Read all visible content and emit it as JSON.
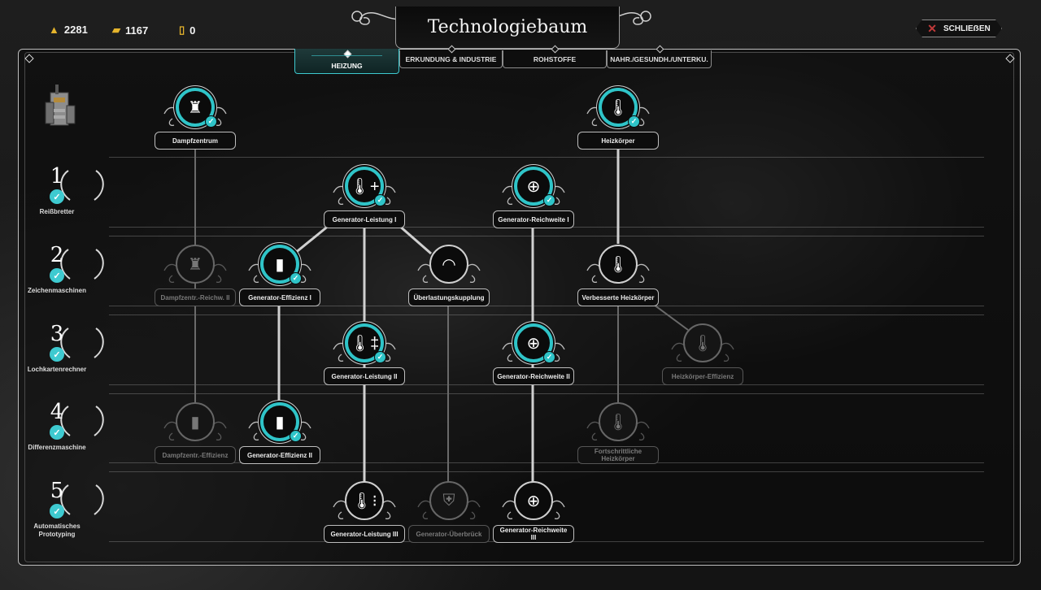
{
  "resources": [
    {
      "icon": "gold-resource-icon",
      "value": "2281"
    },
    {
      "icon": "bar-resource-icon",
      "value": "1167"
    },
    {
      "icon": "core-resource-icon",
      "value": "0"
    }
  ],
  "title": "Technologiebaum",
  "close_label": "SCHLIEẞEN",
  "tabs": [
    {
      "label": "HEIZUNG",
      "active": true
    },
    {
      "label": "ERKUNDUNG & INDUSTRIE",
      "active": false
    },
    {
      "label": "ROHSTOFFE",
      "active": false
    },
    {
      "label": "NAHR./GESUNDH./UNTERKU.",
      "active": false
    }
  ],
  "tiers": [
    {
      "num": "1",
      "label": "Reißbretter"
    },
    {
      "num": "2",
      "label": "Zeichenmaschinen"
    },
    {
      "num": "3",
      "label": "Lochkartenrechner"
    },
    {
      "num": "4",
      "label": "Differenzmaschine"
    },
    {
      "num": "5",
      "label": "Automatisches Prototyping"
    }
  ],
  "accent_color": "#2fc4c8",
  "nodes": {
    "dampfzentrum": {
      "label": "Dampfzentrum",
      "icon": "steam-hub-icon",
      "state": "done"
    },
    "heizkoerper": {
      "label": "Heizkörper",
      "icon": "heater-icon",
      "state": "done"
    },
    "gen_leistung_1": {
      "label": "Generator-Leistung I",
      "icon": "thermometer-plus-icon",
      "state": "done"
    },
    "gen_reichweite_1": {
      "label": "Generator-Reichweite I",
      "icon": "range-icon",
      "state": "done"
    },
    "dampfz_reichw_2": {
      "label": "Dampfzentr.-Reichw. II",
      "icon": "steam-hub-range-icon",
      "state": "locked"
    },
    "gen_effizienz_1": {
      "label": "Generator-Effizienz I",
      "icon": "coal-efficiency-icon",
      "state": "done"
    },
    "ueberlastung": {
      "label": "Überlastungskupplung",
      "icon": "gauge-icon",
      "state": "available"
    },
    "verb_heizkoerper": {
      "label": "Verbesserte Heizkörper",
      "icon": "heater-plus-icon",
      "state": "available"
    },
    "gen_leistung_2": {
      "label": "Generator-Leistung II",
      "icon": "thermometer-double-plus-icon",
      "state": "done"
    },
    "gen_reichweite_2": {
      "label": "Generator-Reichweite II",
      "icon": "range-icon",
      "state": "done"
    },
    "heizk_effizienz": {
      "label": "Heizkörper-Effizienz",
      "icon": "heater-efficiency-icon",
      "state": "locked"
    },
    "dampfz_effizienz": {
      "label": "Dampfzentr.-Effizienz",
      "icon": "steam-hub-efficiency-icon",
      "state": "locked"
    },
    "gen_effizienz_2": {
      "label": "Generator-Effizienz II",
      "icon": "coal-efficiency-icon",
      "state": "done"
    },
    "fort_heizkoerper": {
      "label": "Fortschrittliche Heizkörper",
      "icon": "heater-advanced-icon",
      "state": "locked"
    },
    "gen_leistung_3": {
      "label": "Generator-Leistung III",
      "icon": "thermometer-triple-plus-icon",
      "state": "available"
    },
    "gen_ueberbrueck": {
      "label": "Generator-Überbrück",
      "icon": "shield-icon",
      "state": "locked"
    },
    "gen_reichweite_3": {
      "label": "Generator-Reichweite III",
      "icon": "range-icon",
      "state": "available"
    }
  }
}
